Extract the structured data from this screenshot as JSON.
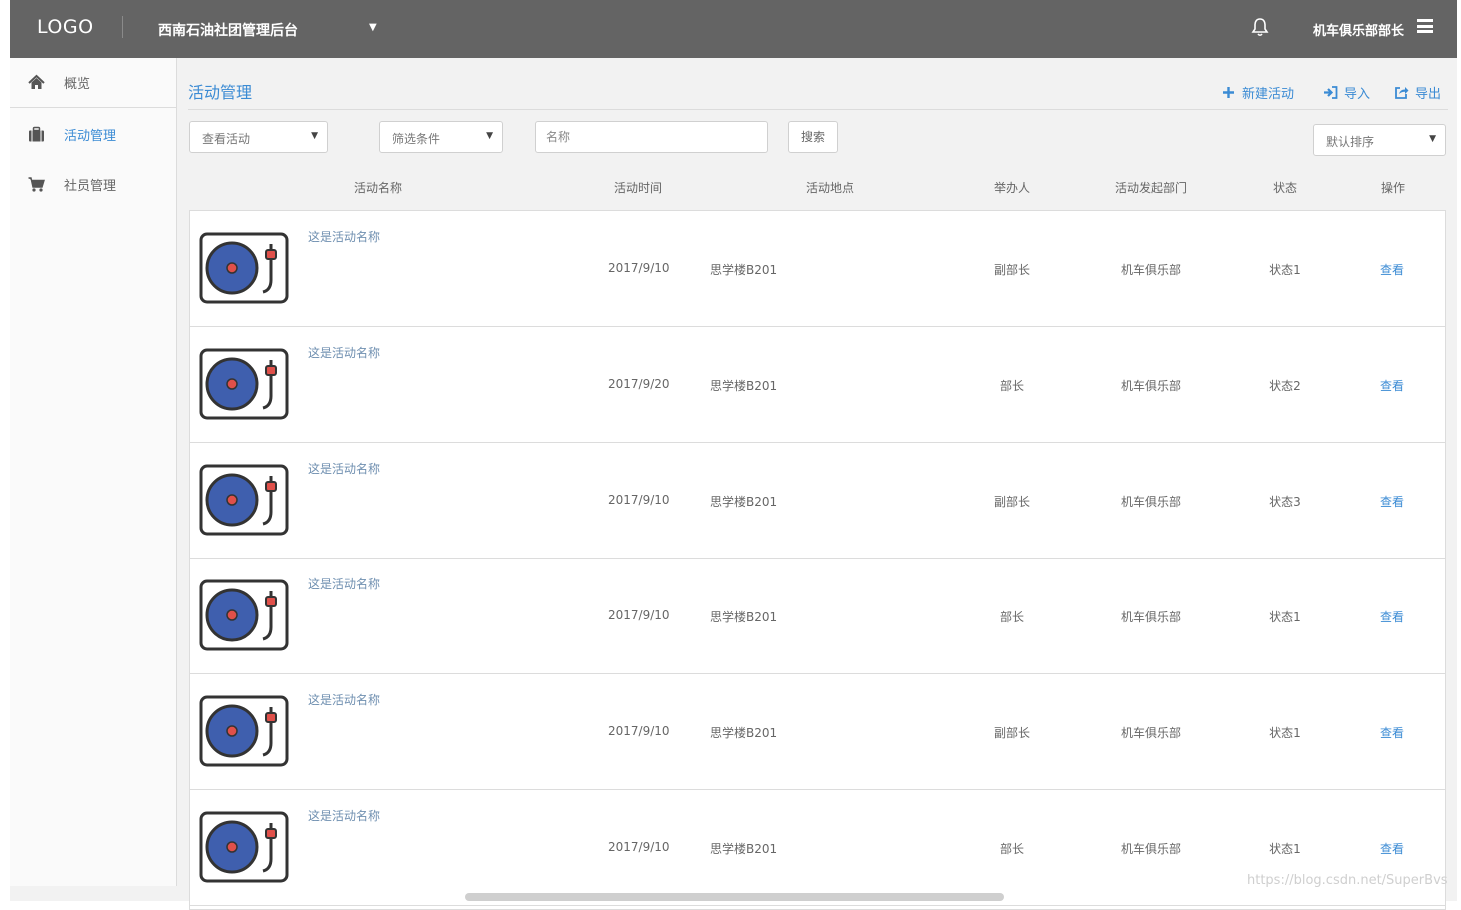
{
  "header": {
    "logo": "LOGO",
    "app_title": "西南石油社团管理后台",
    "user_name": "机车俱乐部部长"
  },
  "sidebar": {
    "items": [
      {
        "label": "概览",
        "icon": "home-icon"
      },
      {
        "label": "活动管理",
        "icon": "briefcase-icon",
        "active": true
      },
      {
        "label": "社员管理",
        "icon": "cart-icon"
      }
    ]
  },
  "main": {
    "title": "活动管理",
    "actions": {
      "new_label": "新建活动",
      "import_label": "导入",
      "export_label": "导出"
    },
    "filters": {
      "view_select": "查看活动",
      "condition_select": "筛选条件",
      "name_placeholder": "名称",
      "search_label": "搜索",
      "sort_select": "默认排序"
    },
    "columns": [
      "活动名称",
      "活动时间",
      "活动地点",
      "举办人",
      "活动发起部门",
      "状态",
      "操作"
    ],
    "rows": [
      {
        "name": "这是活动名称",
        "date": "2017/9/10",
        "place": "思学楼B201",
        "host": "副部长",
        "dept": "机车俱乐部",
        "status": "状态1",
        "action": "查看"
      },
      {
        "name": "这是活动名称",
        "date": "2017/9/20",
        "place": "思学楼B201",
        "host": "部长",
        "dept": "机车俱乐部",
        "status": "状态2",
        "action": "查看"
      },
      {
        "name": "这是活动名称",
        "date": "2017/9/10",
        "place": "思学楼B201",
        "host": "副部长",
        "dept": "机车俱乐部",
        "status": "状态3",
        "action": "查看"
      },
      {
        "name": "这是活动名称",
        "date": "2017/9/10",
        "place": "思学楼B201",
        "host": "部长",
        "dept": "机车俱乐部",
        "status": "状态1",
        "action": "查看"
      },
      {
        "name": "这是活动名称",
        "date": "2017/9/10",
        "place": "思学楼B201",
        "host": "副部长",
        "dept": "机车俱乐部",
        "status": "状态1",
        "action": "查看"
      },
      {
        "name": "这是活动名称",
        "date": "2017/9/10",
        "place": "思学楼B201",
        "host": "部长",
        "dept": "机车俱乐部",
        "status": "状态1",
        "action": "查看"
      }
    ]
  },
  "watermark": "https://blog.csdn.net/SuperBvs",
  "colors": {
    "header_bg": "#646464",
    "accent": "#3b8bd4",
    "record_blue": "#3f5fae",
    "record_red": "#e0504a"
  }
}
